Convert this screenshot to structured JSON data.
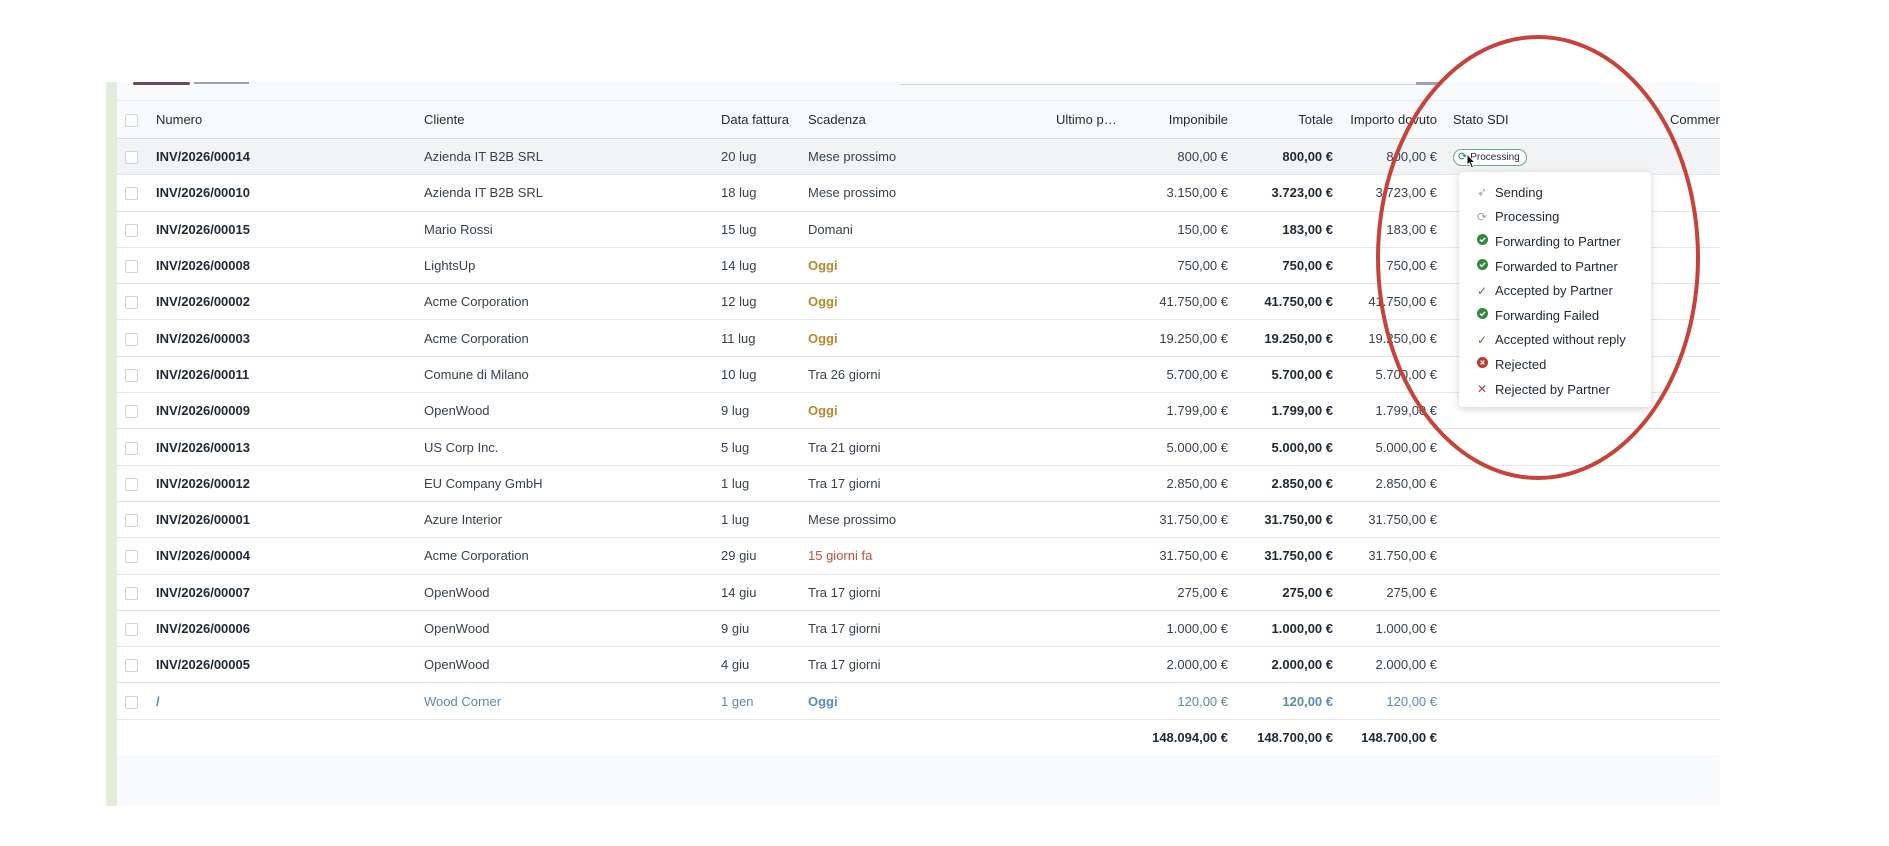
{
  "columns": {
    "numero": "Numero",
    "cliente": "Cliente",
    "data_fattura": "Data fattura",
    "scadenza": "Scadenza",
    "ultimo": "Ultimo pro…",
    "imponibile": "Imponibile",
    "totale": "Totale",
    "importo_dovuto": "Importo dovuto",
    "stato_sdi": "Stato SDI",
    "commenti": "Commer"
  },
  "rows": [
    {
      "numero": "INV/2026/00014",
      "cliente": "Azienda IT B2B SRL",
      "data": "20 lug",
      "scadenza": "Mese prossimo",
      "scad_style": "normal",
      "imponibile": "800,00 €",
      "totale": "800,00 €",
      "dovuto": "800,00 €",
      "stato": "Processing"
    },
    {
      "numero": "INV/2026/00010",
      "cliente": "Azienda IT B2B SRL",
      "data": "18 lug",
      "scadenza": "Mese prossimo",
      "scad_style": "normal",
      "imponibile": "3.150,00 €",
      "totale": "3.723,00 €",
      "dovuto": "3.723,00 €",
      "stato": ""
    },
    {
      "numero": "INV/2026/00015",
      "cliente": "Mario Rossi",
      "data": "15 lug",
      "scadenza": "Domani",
      "scad_style": "normal",
      "imponibile": "150,00 €",
      "totale": "183,00 €",
      "dovuto": "183,00 €",
      "stato": ""
    },
    {
      "numero": "INV/2026/00008",
      "cliente": "LightsUp",
      "data": "14 lug",
      "scadenza": "Oggi",
      "scad_style": "warn",
      "imponibile": "750,00 €",
      "totale": "750,00 €",
      "dovuto": "750,00 €",
      "stato": ""
    },
    {
      "numero": "INV/2026/00002",
      "cliente": "Acme Corporation",
      "data": "12 lug",
      "scadenza": "Oggi",
      "scad_style": "warn",
      "imponibile": "41.750,00 €",
      "totale": "41.750,00 €",
      "dovuto": "41.750,00 €",
      "stato": ""
    },
    {
      "numero": "INV/2026/00003",
      "cliente": "Acme Corporation",
      "data": "11 lug",
      "scadenza": "Oggi",
      "scad_style": "warn",
      "imponibile": "19.250,00 €",
      "totale": "19.250,00 €",
      "dovuto": "19.250,00 €",
      "stato": ""
    },
    {
      "numero": "INV/2026/00011",
      "cliente": "Comune di Milano",
      "data": "10 lug",
      "scadenza": "Tra 26 giorni",
      "scad_style": "normal",
      "imponibile": "5.700,00 €",
      "totale": "5.700,00 €",
      "dovuto": "5.700,00 €",
      "stato": ""
    },
    {
      "numero": "INV/2026/00009",
      "cliente": "OpenWood",
      "data": "9 lug",
      "scadenza": "Oggi",
      "scad_style": "warn",
      "imponibile": "1.799,00 €",
      "totale": "1.799,00 €",
      "dovuto": "1.799,00 €",
      "stato": ""
    },
    {
      "numero": "INV/2026/00013",
      "cliente": "US Corp Inc.",
      "data": "5 lug",
      "scadenza": "Tra 21 giorni",
      "scad_style": "normal",
      "imponibile": "5.000,00 €",
      "totale": "5.000,00 €",
      "dovuto": "5.000,00 €",
      "stato": ""
    },
    {
      "numero": "INV/2026/00012",
      "cliente": "EU Company GmbH",
      "data": "1 lug",
      "scadenza": "Tra 17 giorni",
      "scad_style": "normal",
      "imponibile": "2.850,00 €",
      "totale": "2.850,00 €",
      "dovuto": "2.850,00 €",
      "stato": ""
    },
    {
      "numero": "INV/2026/00001",
      "cliente": "Azure Interior",
      "data": "1 lug",
      "scadenza": "Mese prossimo",
      "scad_style": "normal",
      "imponibile": "31.750,00 €",
      "totale": "31.750,00 €",
      "dovuto": "31.750,00 €",
      "stato": ""
    },
    {
      "numero": "INV/2026/00004",
      "cliente": "Acme Corporation",
      "data": "29 giu",
      "scadenza": "15 giorni fa",
      "scad_style": "danger",
      "imponibile": "31.750,00 €",
      "totale": "31.750,00 €",
      "dovuto": "31.750,00 €",
      "stato": ""
    },
    {
      "numero": "INV/2026/00007",
      "cliente": "OpenWood",
      "data": "14 giu",
      "scadenza": "Tra 17 giorni",
      "scad_style": "normal",
      "imponibile": "275,00 €",
      "totale": "275,00 €",
      "dovuto": "275,00 €",
      "stato": ""
    },
    {
      "numero": "INV/2026/00006",
      "cliente": "OpenWood",
      "data": "9 giu",
      "scadenza": "Tra 17 giorni",
      "scad_style": "normal",
      "imponibile": "1.000,00 €",
      "totale": "1.000,00 €",
      "dovuto": "1.000,00 €",
      "stato": ""
    },
    {
      "numero": "INV/2026/00005",
      "cliente": "OpenWood",
      "data": "4 giu",
      "scadenza": "Tra 17 giorni",
      "scad_style": "normal",
      "imponibile": "2.000,00 €",
      "totale": "2.000,00 €",
      "dovuto": "2.000,00 €",
      "stato": ""
    },
    {
      "numero": "/",
      "cliente": "Wood Corner",
      "data": "1 gen",
      "scadenza": "Oggi",
      "scad_style": "warn",
      "imponibile": "120,00 €",
      "totale": "120,00 €",
      "dovuto": "120,00 €",
      "stato": "",
      "muted": true
    }
  ],
  "totals": {
    "imponibile": "148.094,00 €",
    "totale": "148.700,00 €",
    "dovuto": "148.700,00 €"
  },
  "status_menu": [
    {
      "label": "Sending",
      "icon": "send-icon"
    },
    {
      "label": "Processing",
      "icon": "refresh-icon"
    },
    {
      "label": "Forwarding to Partner",
      "icon": "check-circle-icon"
    },
    {
      "label": "Forwarded to Partner",
      "icon": "check-circle-icon"
    },
    {
      "label": "Accepted by Partner",
      "icon": "check-icon"
    },
    {
      "label": "Forwarding Failed",
      "icon": "check-circle-icon"
    },
    {
      "label": "Accepted without reply",
      "icon": "check-icon"
    },
    {
      "label": "Rejected",
      "icon": "x-circle-icon"
    },
    {
      "label": "Rejected by Partner",
      "icon": "x-icon"
    }
  ],
  "colors": {
    "annotation_circle": "#c74238",
    "warn": "#b7892e",
    "danger": "#c0503a",
    "muted_link": "#5b8bb5",
    "success": "#2e8b3c"
  }
}
